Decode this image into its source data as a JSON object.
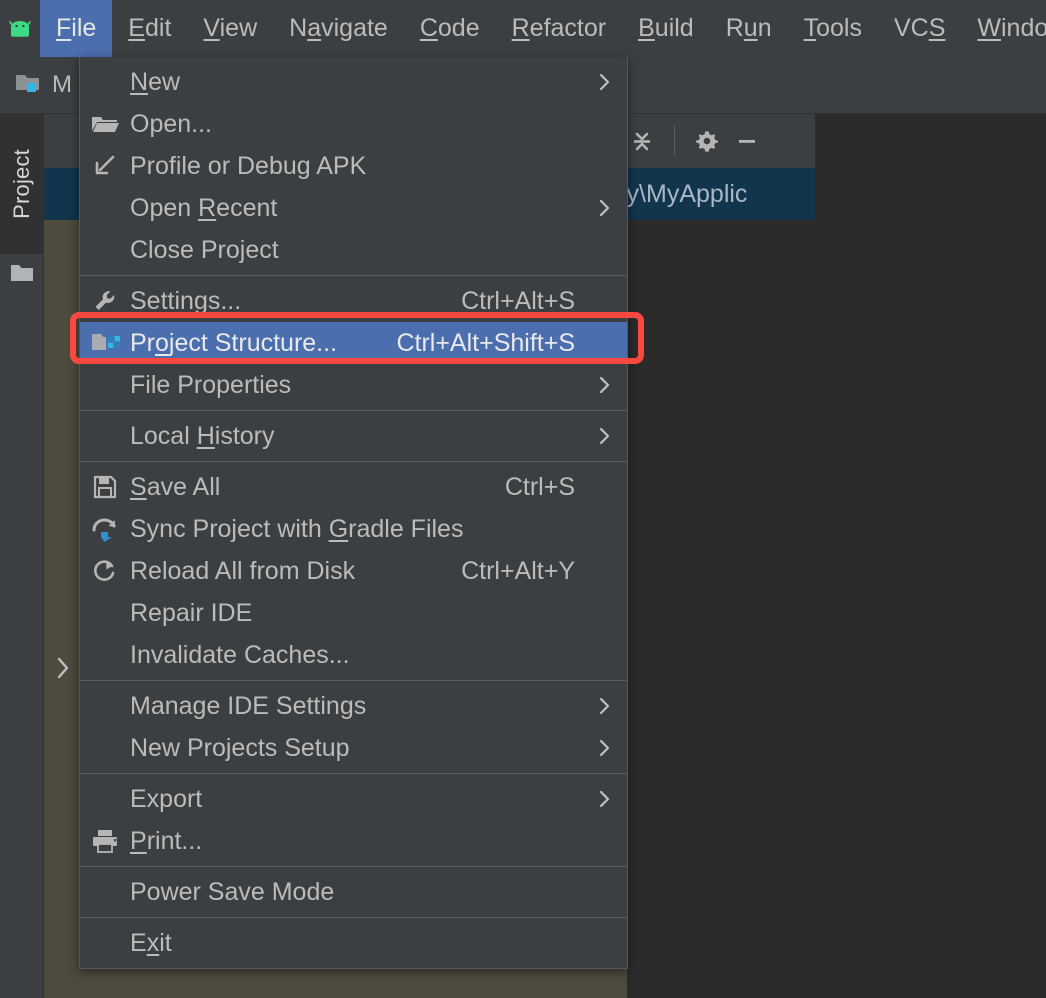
{
  "menubar": {
    "logo_icon": "android-logo-icon",
    "items": [
      {
        "label": "File",
        "mnemonic_index": 0,
        "active": true
      },
      {
        "label": "Edit",
        "mnemonic_index": 0,
        "active": false
      },
      {
        "label": "View",
        "mnemonic_index": 0,
        "active": false
      },
      {
        "label": "Navigate",
        "mnemonic_index": 1,
        "active": false
      },
      {
        "label": "Code",
        "mnemonic_index": 0,
        "active": false
      },
      {
        "label": "Refactor",
        "mnemonic_index": 0,
        "active": false
      },
      {
        "label": "Build",
        "mnemonic_index": 0,
        "active": false
      },
      {
        "label": "Run",
        "mnemonic_index": 1,
        "active": false
      },
      {
        "label": "Tools",
        "mnemonic_index": 0,
        "active": false
      },
      {
        "label": "VCS",
        "mnemonic_index": 2,
        "active": false
      },
      {
        "label": "Window",
        "mnemonic_index": 0,
        "active": false
      }
    ]
  },
  "breadcrumb": {
    "icon": "module-folder-icon",
    "label": "M"
  },
  "left_stripe": {
    "tab_label": "Project",
    "folder_icon": "folder-icon"
  },
  "tree_panel": {
    "toolbar": {
      "collapse_all_icon": "collapse-all-icon",
      "settings_icon": "gear-icon",
      "hide_icon": "minimize-icon"
    },
    "selected_row_text": "_funny\\MyApplic",
    "expand_chevron_icon": "chevron-down-icon",
    "collapse_chevron_icon": "chevron-right-icon"
  },
  "file_menu": {
    "groups": [
      {
        "items": [
          {
            "label": "New",
            "icon": null,
            "accel": "",
            "submenu": true,
            "selected": false,
            "mnemonic_index": 0
          },
          {
            "label": "Open...",
            "icon": "folder-open-icon",
            "accel": "",
            "submenu": false,
            "selected": false,
            "mnemonic_index": -1
          },
          {
            "label": "Profile or Debug APK",
            "icon": "profile-apk-icon",
            "accel": "",
            "submenu": false,
            "selected": false,
            "mnemonic_index": -1
          },
          {
            "label": "Open Recent",
            "icon": null,
            "accel": "",
            "submenu": true,
            "selected": false,
            "mnemonic_index": 5
          },
          {
            "label": "Close Project",
            "icon": null,
            "accel": "",
            "submenu": false,
            "selected": false,
            "mnemonic_index": -1
          }
        ]
      },
      {
        "items": [
          {
            "label": "Settings...",
            "icon": "wrench-icon",
            "accel": "Ctrl+Alt+S",
            "submenu": false,
            "selected": false,
            "mnemonic_index": 3
          },
          {
            "label": "Project Structure...",
            "icon": "project-structure-icon",
            "accel": "Ctrl+Alt+Shift+S",
            "submenu": false,
            "selected": true,
            "mnemonic_index": 2
          },
          {
            "label": "File Properties",
            "icon": null,
            "accel": "",
            "submenu": true,
            "selected": false,
            "mnemonic_index": -1
          }
        ]
      },
      {
        "items": [
          {
            "label": "Local History",
            "icon": null,
            "accel": "",
            "submenu": true,
            "selected": false,
            "mnemonic_index": 6
          }
        ]
      },
      {
        "items": [
          {
            "label": "Save All",
            "icon": "save-icon",
            "accel": "Ctrl+S",
            "submenu": false,
            "selected": false,
            "mnemonic_index": 0
          },
          {
            "label": "Sync Project with Gradle Files",
            "icon": "sync-gradle-icon",
            "accel": "",
            "submenu": false,
            "selected": false,
            "mnemonic_index": 18
          },
          {
            "label": "Reload All from Disk",
            "icon": "reload-icon",
            "accel": "Ctrl+Alt+Y",
            "submenu": false,
            "selected": false,
            "mnemonic_index": -1
          },
          {
            "label": "Repair IDE",
            "icon": null,
            "accel": "",
            "submenu": false,
            "selected": false,
            "mnemonic_index": -1
          },
          {
            "label": "Invalidate Caches...",
            "icon": null,
            "accel": "",
            "submenu": false,
            "selected": false,
            "mnemonic_index": -1
          }
        ]
      },
      {
        "items": [
          {
            "label": "Manage IDE Settings",
            "icon": null,
            "accel": "",
            "submenu": true,
            "selected": false,
            "mnemonic_index": -1
          },
          {
            "label": "New Projects Setup",
            "icon": null,
            "accel": "",
            "submenu": true,
            "selected": false,
            "mnemonic_index": -1
          }
        ]
      },
      {
        "items": [
          {
            "label": "Export",
            "icon": null,
            "accel": "",
            "submenu": true,
            "selected": false,
            "mnemonic_index": -1
          },
          {
            "label": "Print...",
            "icon": "printer-icon",
            "accel": "",
            "submenu": false,
            "selected": false,
            "mnemonic_index": 0
          }
        ]
      },
      {
        "items": [
          {
            "label": "Power Save Mode",
            "icon": null,
            "accel": "",
            "submenu": false,
            "selected": false,
            "mnemonic_index": -1
          }
        ]
      },
      {
        "items": [
          {
            "label": "Exit",
            "icon": null,
            "accel": "",
            "submenu": false,
            "selected": false,
            "mnemonic_index": 1
          }
        ]
      }
    ]
  },
  "annotation": {
    "type": "red-rectangle-highlight",
    "target": "Project Structure...",
    "color": "#f9483f"
  },
  "colors": {
    "menubar_bg": "#3c3f41",
    "menu_bg": "#3c3f41",
    "menu_text": "#bbbbbb",
    "selection_blue": "#4b6eaf",
    "tree_row_selected": "#11354d",
    "panel_olive": "#4d4a3e",
    "editor_bg": "#2b2b2b",
    "annotation_red": "#f9483f"
  }
}
